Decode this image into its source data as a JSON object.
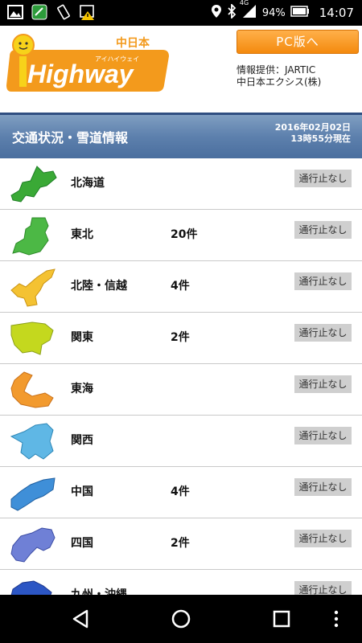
{
  "statusbar": {
    "time": "14:07",
    "battery": "94%",
    "network": "4G"
  },
  "header": {
    "logo_text": "iHighway",
    "logo_sub_top": "中日本",
    "logo_sub_kana": "アイハイウェイ",
    "pc_button": "PC版へ",
    "provider_line1": "情報提供：JARTIC",
    "provider_line2": "中日本エクシス(株)"
  },
  "section": {
    "title": "交通状況・雪道情報",
    "date": "2016年02月02日",
    "time": "13時55分現在"
  },
  "regions": [
    {
      "name": "北海道",
      "count": "",
      "status": "通行止なし",
      "color": "#3aa936"
    },
    {
      "name": "東北",
      "count": "20件",
      "status": "通行止なし",
      "color": "#4cb845"
    },
    {
      "name": "北陸・信越",
      "count": "4件",
      "status": "通行止なし",
      "color": "#f4c232"
    },
    {
      "name": "関東",
      "count": "2件",
      "status": "通行止なし",
      "color": "#c4d81e"
    },
    {
      "name": "東海",
      "count": "",
      "status": "通行止なし",
      "color": "#f29a2e"
    },
    {
      "name": "関西",
      "count": "",
      "status": "通行止なし",
      "color": "#5fb7e5"
    },
    {
      "name": "中国",
      "count": "4件",
      "status": "通行止なし",
      "color": "#3f8fd8"
    },
    {
      "name": "四国",
      "count": "2件",
      "status": "通行止なし",
      "color": "#6f80d6"
    },
    {
      "name": "九州・沖縄",
      "count": "",
      "status": "通行止なし",
      "color": "#2c56c4"
    }
  ]
}
